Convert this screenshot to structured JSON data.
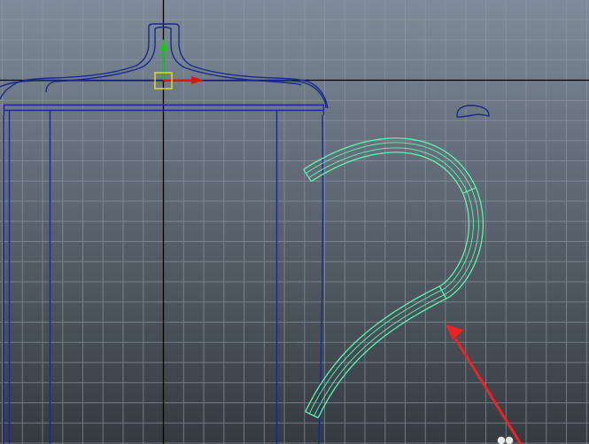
{
  "viewport": {
    "view": "front-orthographic",
    "background_top": "#7f8b9a",
    "background_bottom": "#343a40",
    "grid_color": "#8e97a3",
    "axis_color": "#000000",
    "wireframe_color": "#1a2a8c",
    "selected_wireframe_color": "#5cf5b0"
  },
  "objects": [
    {
      "name": "teapot-body",
      "state": "unselected"
    },
    {
      "name": "teapot-lid",
      "state": "unselected"
    },
    {
      "name": "lid-knob",
      "state": "unselected"
    },
    {
      "name": "handle-curve",
      "state": "selected"
    }
  ],
  "manipulator": {
    "type": "move-tool",
    "x_axis_color": "#d11a1a",
    "y_axis_color": "#1bc41b",
    "center_color": "#e8e020"
  },
  "annotation": {
    "type": "arrow",
    "color": "#ee2222",
    "points_to": "handle-curve"
  },
  "cursor": {
    "icon": "cursor-dots-icon"
  }
}
